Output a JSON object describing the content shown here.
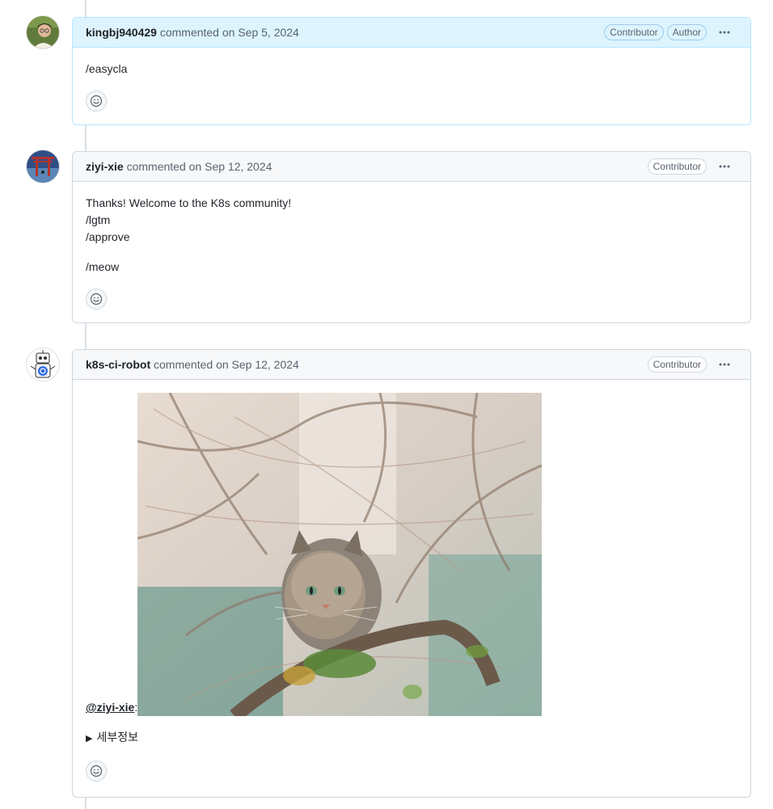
{
  "comments": [
    {
      "username": "kingbj940429",
      "action": "commented",
      "date": "on Sep 5, 2024",
      "badges": [
        "Contributor",
        "Author"
      ],
      "body_lines": [
        "/easycla"
      ]
    },
    {
      "username": "ziyi-xie",
      "action": "commented",
      "date": "on Sep 12, 2024",
      "badges": [
        "Contributor"
      ],
      "body_lines": [
        "Thanks! Welcome to the K8s community!",
        "/lgtm",
        "/approve",
        "/meow"
      ]
    },
    {
      "username": "k8s-ci-robot",
      "action": "commented",
      "date": "on Sep 12, 2024",
      "badges": [
        "Contributor"
      ],
      "mention": "@ziyi-xie",
      "mention_suffix": ":",
      "details_label": "세부정보"
    }
  ],
  "icons": {
    "kebab": "kebab-horizontal-icon",
    "reaction": "smiley-icon",
    "disclosure": "triangle-right-icon"
  },
  "colors": {
    "author_header": "#ddf4ff",
    "author_border": "#b6e3ff",
    "header_bg": "#f6f8fa",
    "border": "#d0d7de"
  }
}
